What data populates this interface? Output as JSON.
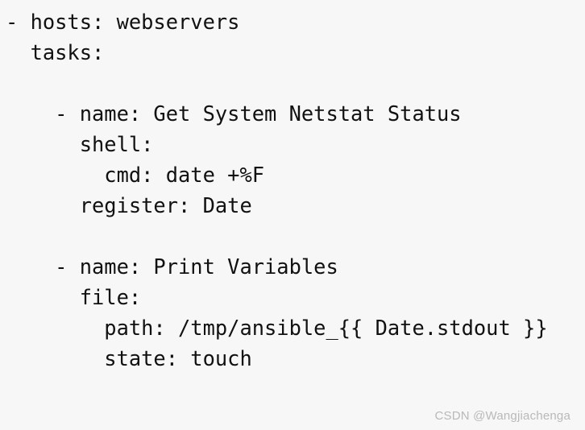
{
  "document": {
    "type": "ansible-playbook-yaml",
    "background_color": "#f7f7f7",
    "text_color": "#111111",
    "lines": [
      "- hosts: webservers",
      "  tasks:",
      "",
      "    - name: Get System Netstat Status",
      "      shell:",
      "        cmd: date +%F",
      "      register: Date",
      "",
      "    - name: Print Variables",
      "      file:",
      "        path: /tmp/ansible_{{ Date.stdout }}",
      "        state: touch"
    ]
  },
  "watermark": {
    "text": "CSDN @Wangjiachenga",
    "color": "#b9b9b9"
  }
}
